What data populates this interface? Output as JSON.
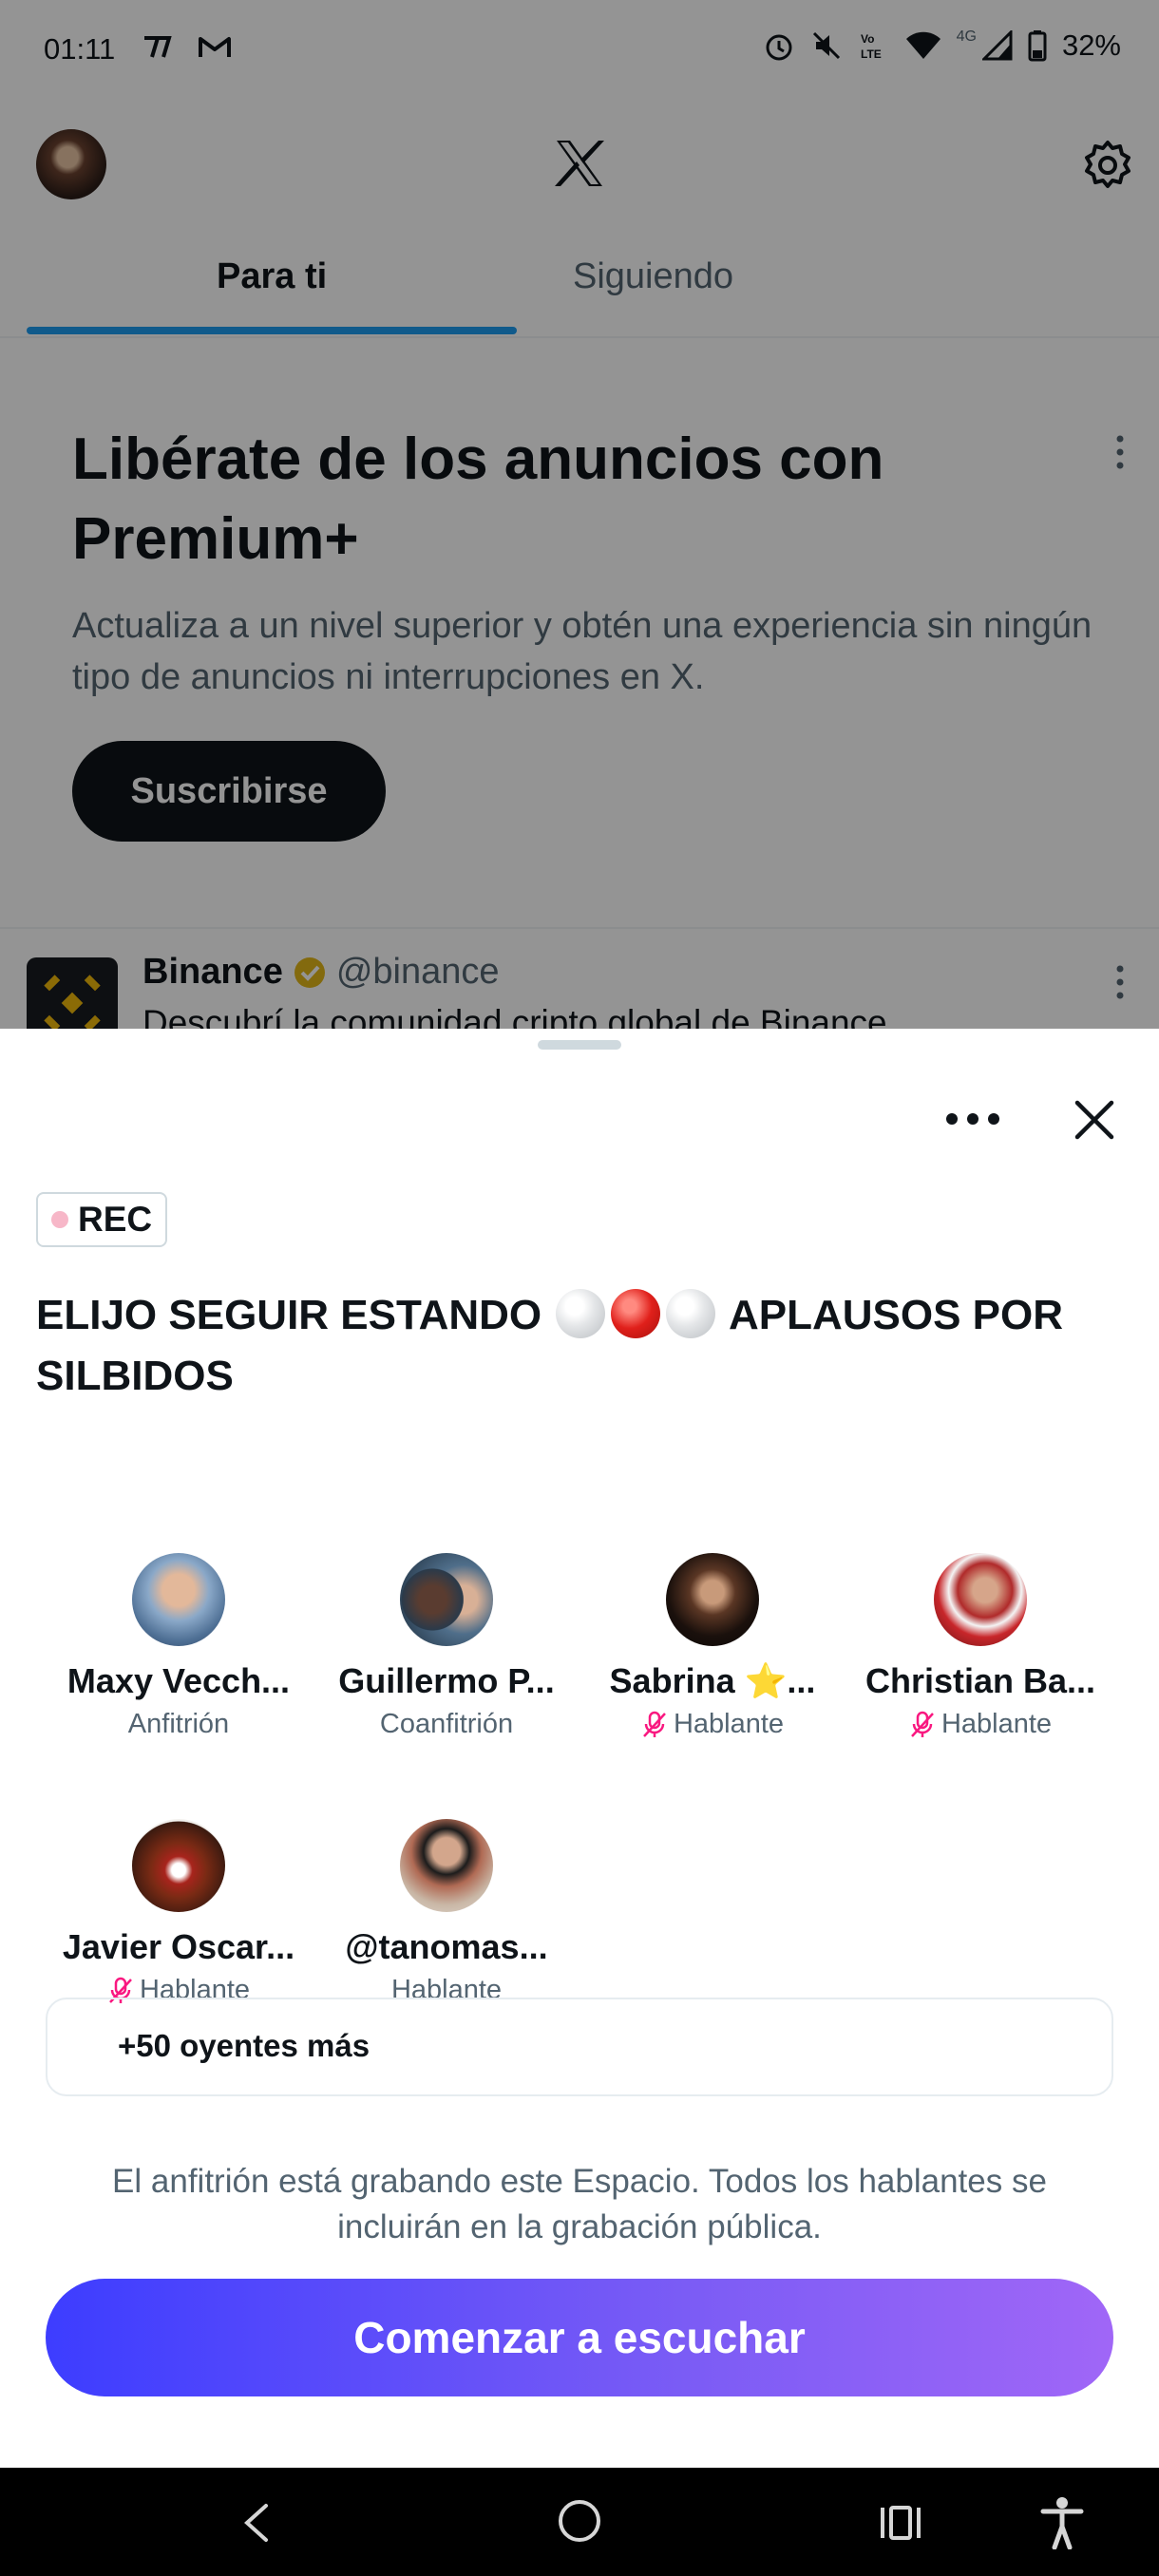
{
  "status_bar": {
    "time": "01:11",
    "battery": "32%",
    "network": "4G"
  },
  "feed": {
    "tabs": [
      {
        "label": "Para ti",
        "active": true
      },
      {
        "label": "Siguiendo",
        "active": false
      }
    ],
    "promo": {
      "title": "Libérate de los anuncios con Premium+",
      "description": "Actualiza a un nivel superior y obtén una experiencia sin ningún tipo de anuncios ni interrupciones en X.",
      "button": "Suscribirse"
    },
    "post": {
      "name": "Binance",
      "handle": "@binance",
      "text": "Descubrí la comunidad cripto global de Binance"
    }
  },
  "space": {
    "rec_label": "REC",
    "title_part1": "ELIJO SEGUIR ESTANDO",
    "title_part2": "APLAUSOS POR SILBIDOS",
    "speakers": [
      {
        "name": "Maxy Vecch...",
        "role": "Anfitrión",
        "muted": false
      },
      {
        "name": "Guillermo P...",
        "role": "Coanfitrión",
        "muted": false
      },
      {
        "name": "Sabrina ⭐...",
        "role": "Hablante",
        "muted": true
      },
      {
        "name": "Christian Ba...",
        "role": "Hablante",
        "muted": true
      },
      {
        "name": "Javier Oscar...",
        "role": "Hablante",
        "muted": true
      },
      {
        "name": "@tanomas...",
        "role": "Hablante",
        "muted": false
      }
    ],
    "listeners": "+50 oyentes más",
    "notice": "El anfitrión está grabando este Espacio. Todos los hablantes se incluirán en la grabación pública.",
    "cta": "Comenzar a escuchar"
  },
  "colors": {
    "accent_blue": "#1d9bf0",
    "cta_gradient_start": "#3d3dff",
    "cta_gradient_end": "#a066f7",
    "muted_mic": "#f91880",
    "rec_dot": "#f7b7c8"
  }
}
